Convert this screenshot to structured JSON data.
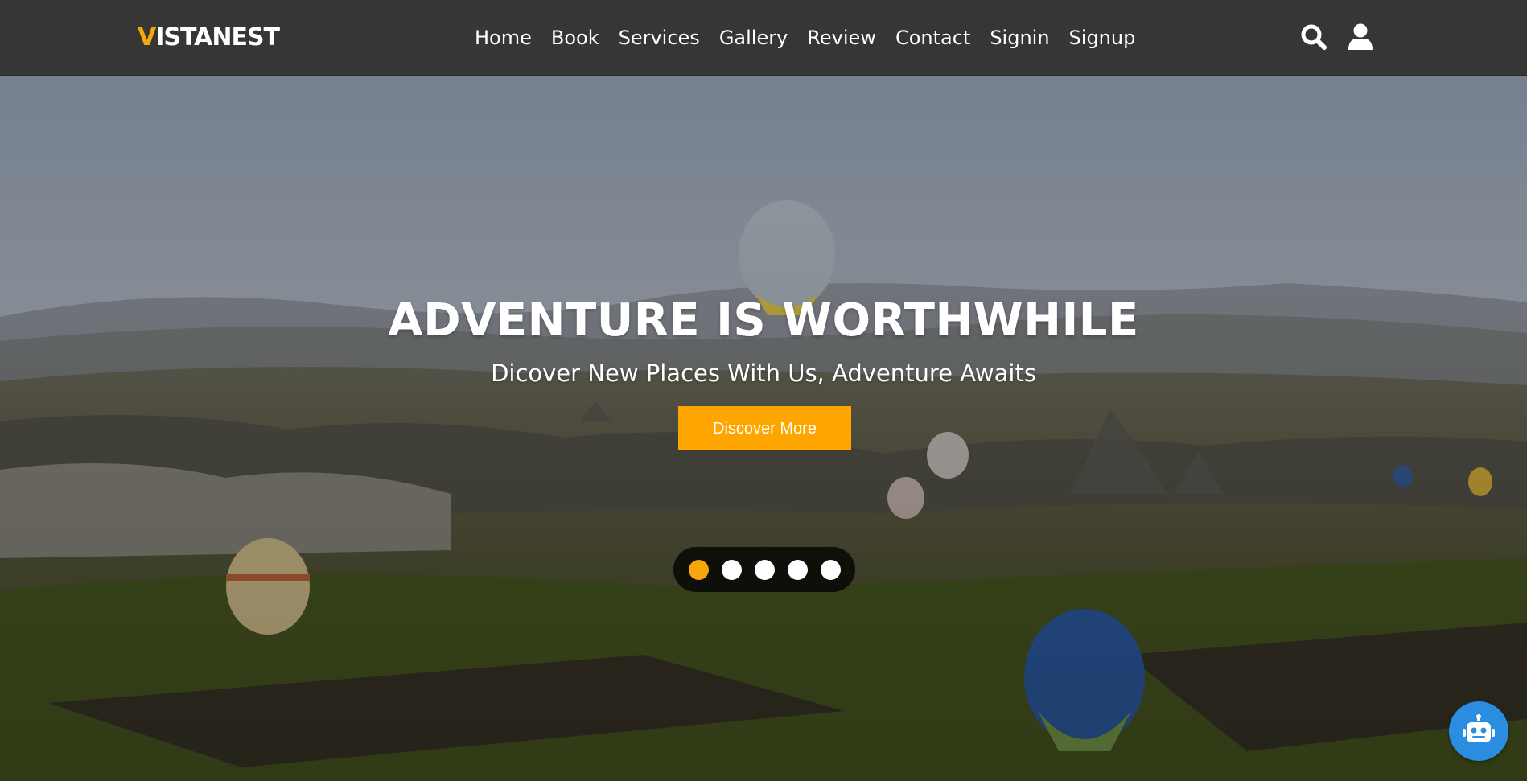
{
  "brand": {
    "first_letter": "V",
    "rest": "ISTANEST",
    "accent_color": "#f7a70c"
  },
  "nav": {
    "links": [
      "Home",
      "Book",
      "Services",
      "Gallery",
      "Review",
      "Contact",
      "Signin",
      "Signup"
    ],
    "icons": [
      "search-icon",
      "user-icon"
    ]
  },
  "hero": {
    "title": "ADVENTURE IS WORTHWHILE",
    "subtitle": "Dicover New Places With Us, Adventure Awaits",
    "cta_label": "Discover More",
    "cta_color": "#ffa500",
    "slides_count": 5,
    "active_slide": 1
  },
  "chatbot": {
    "icon": "robot-icon",
    "color": "#2a8de0"
  }
}
